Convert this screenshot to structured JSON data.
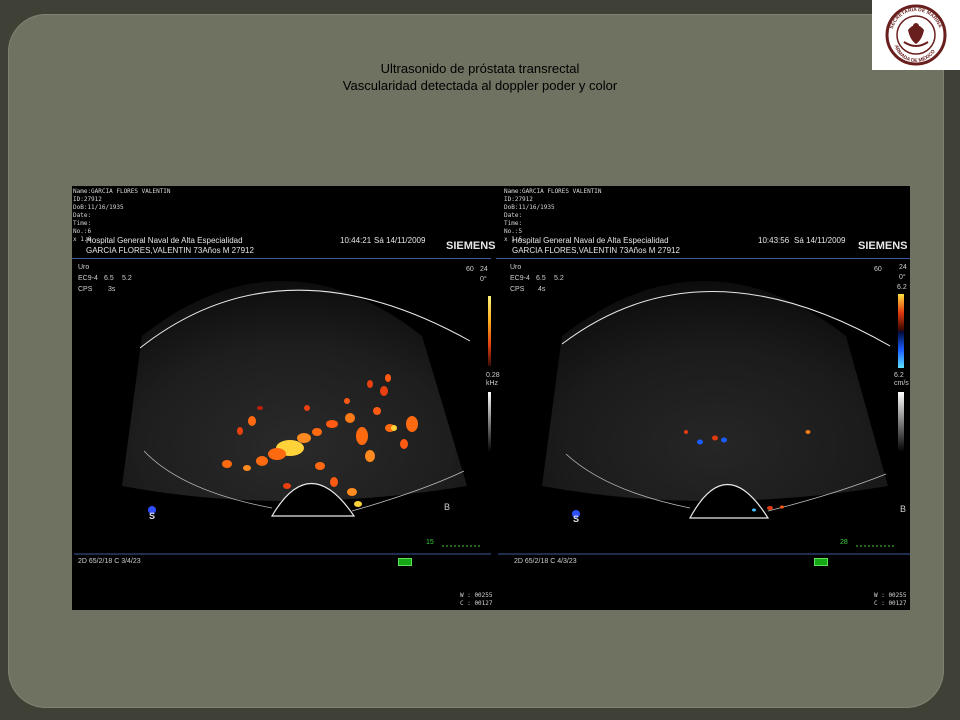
{
  "slide": {
    "title_line1": "Ultrasonido de próstata transrectal",
    "title_line2": "Vascularidad detectada al doppler poder y color"
  },
  "logo": {
    "icon": "secretaria-de-marina-seal-icon",
    "text": "SECRETARÍA DE MARINA ARMADA DE MÉXICO"
  },
  "images": [
    {
      "patient_block": "Name:GARCIA FLORES VALENTIN\nID:27912\nDoB:11/16/1935\nDate:\nTime:\nNo.:6\nx 1.6",
      "hospital": "Hospital General Naval de Alta Especialidad",
      "patient_line": "GARCIA FLORES,VALENTIN 73Años M 27912",
      "time": "10:44:21",
      "date": "Sá 14/11/2009",
      "brand": "SIEMENS",
      "preset": "Uro",
      "probe": "EC9-4",
      "freq": "6.5",
      "depth": "5.2",
      "mode": "CPS",
      "mode_val": "3s",
      "frame_rate": "60",
      "scale_top": "24",
      "scale_angle": "0°",
      "scale_bottom_value": "0.28",
      "scale_bottom_unit": "kHz",
      "scale_mid": "",
      "marker_b": "B",
      "gain_label": "15",
      "bottom_settings": "2D 65/2/18  C 3/4/23",
      "wc": "W : 00255\nC : 00127",
      "doppler_mode": "power",
      "colors": {
        "flow_strong": "#ffd23a",
        "flow_mid": "#ff6a10",
        "flow_low": "#c0200a"
      }
    },
    {
      "patient_block": "Name:GARCIA FLORES VALENTIN\nID:27912\nDoB:11/16/1935\nDate:\nTime:\nNo.:5\nx 1.6",
      "hospital": "Hospital General Naval de Alta Especialidad",
      "patient_line": "GARCIA FLORES,VALENTIN 73Años M 27912",
      "time": "10:43:56",
      "date": "Sá 14/11/2009",
      "brand": "SIEMENS",
      "preset": "Uro",
      "probe": "EC9-4",
      "freq": "6.5",
      "depth": "5.2",
      "mode": "CPS",
      "mode_val": "4s",
      "frame_rate": "60",
      "scale_top": "24",
      "scale_angle": "0°",
      "scale_top_value": "6.2",
      "scale_bottom_value": "6.2",
      "scale_bottom_unit": "cm/s",
      "marker_b": "B",
      "gain_label": "28",
      "bottom_settings": "2D 65/2/18  C 4/3/23",
      "wc": "W : 00255\nC : 00127",
      "doppler_mode": "color",
      "colors": {
        "flow_toward": "#e03a10",
        "flow_away": "#1a5cff"
      }
    }
  ]
}
